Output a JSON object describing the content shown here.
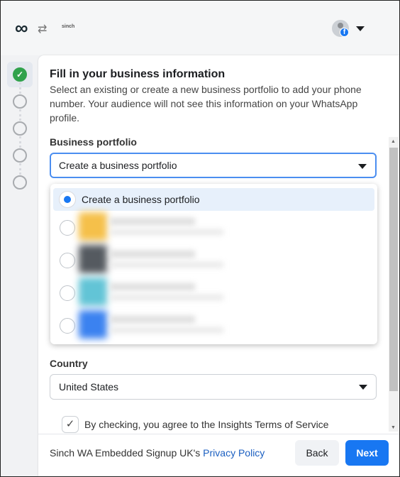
{
  "header": {
    "meta_logo": "∞",
    "swap_icon": "swap-icon",
    "partner_logo": "sinch",
    "account_badge": "f"
  },
  "steps": [
    {
      "state": "done"
    },
    {
      "state": "pending"
    },
    {
      "state": "pending"
    },
    {
      "state": "pending"
    },
    {
      "state": "pending"
    }
  ],
  "main": {
    "title": "Fill in your business information",
    "description": "Select an existing or create a new business portfolio to add your phone number. Your audience will not see this information on your WhatsApp profile.",
    "portfolio_label": "Business portfolio",
    "portfolio_value": "Create a business portfolio",
    "portfolio_options": [
      {
        "label": "Create a business portfolio",
        "selected": true
      },
      {
        "label": "",
        "blurred": true,
        "color": "#f5c04a"
      },
      {
        "label": "",
        "blurred": true,
        "color": "#555a60"
      },
      {
        "label": "",
        "blurred": true,
        "color": "#62c4d6"
      },
      {
        "label": "",
        "blurred": true,
        "color": "#3b82f0"
      }
    ],
    "country_label": "Country",
    "country_value": "United States",
    "terms_checked": true,
    "terms_text": "By checking, you agree to the Insights Terms of Service"
  },
  "footer": {
    "policy_prefix": "Sinch WA Embedded Signup UK's ",
    "policy_link": "Privacy Policy",
    "back": "Back",
    "next": "Next"
  },
  "colors": {
    "accent": "#1877f2",
    "success": "#31a24c"
  }
}
